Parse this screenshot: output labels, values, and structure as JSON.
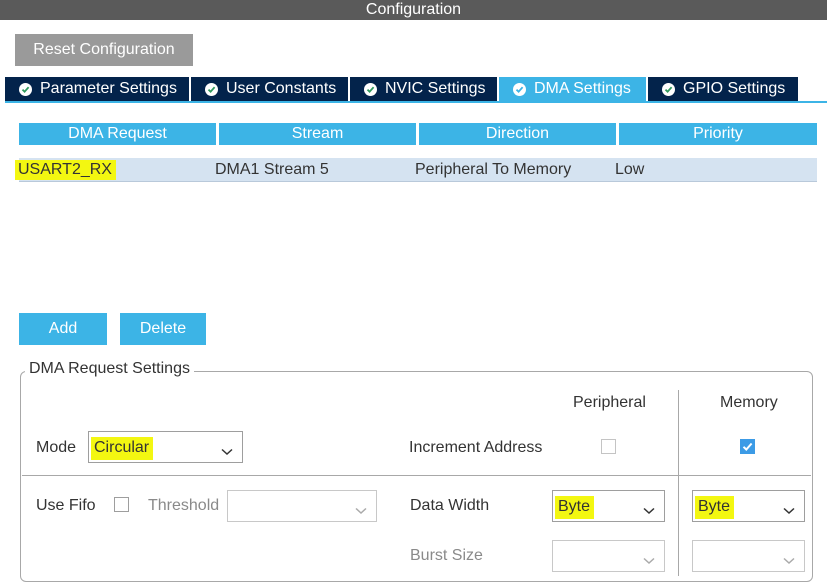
{
  "window": {
    "title": "Configuration"
  },
  "toolbar": {
    "reset_label": "Reset Configuration"
  },
  "tabs": [
    {
      "label": "Parameter Settings",
      "active": false
    },
    {
      "label": "User Constants",
      "active": false
    },
    {
      "label": "NVIC Settings",
      "active": false
    },
    {
      "label": "DMA Settings",
      "active": true
    },
    {
      "label": "GPIO Settings",
      "active": false
    }
  ],
  "dma_table": {
    "columns": [
      "DMA Request",
      "Stream",
      "Direction",
      "Priority"
    ],
    "rows": [
      {
        "request": "USART2_RX",
        "stream": "DMA1 Stream 5",
        "direction": "Peripheral To Memory",
        "priority": "Low"
      }
    ]
  },
  "actions": {
    "add_label": "Add",
    "delete_label": "Delete"
  },
  "settings": {
    "title": "DMA Request Settings",
    "peripheral_header": "Peripheral",
    "memory_header": "Memory",
    "mode_label": "Mode",
    "mode_value": "Circular",
    "increment_label": "Increment Address",
    "increment_peripheral": false,
    "increment_memory": true,
    "use_fifo_label": "Use Fifo",
    "use_fifo": false,
    "threshold_label": "Threshold",
    "threshold_value": "",
    "data_width_label": "Data Width",
    "peripheral_width": "Byte",
    "memory_width": "Byte",
    "burst_size_label": "Burst Size",
    "peripheral_burst": "",
    "memory_burst": ""
  },
  "colors": {
    "tab_bg": "#03234b",
    "accent": "#3cb4e6",
    "highlight": "#f3f711",
    "selected_row": "#d5e3f1",
    "checkbox_checked": "#3c9be6"
  }
}
